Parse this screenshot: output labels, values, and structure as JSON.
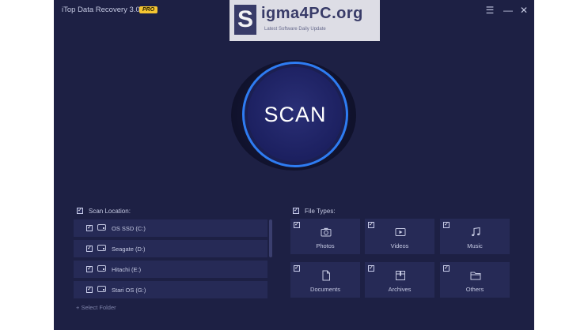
{
  "titlebar": {
    "app_title": "iTop Data Recovery 3.0",
    "badge": "PRO",
    "menu_glyph": "☰",
    "minimize_glyph": "—",
    "close_glyph": "✕"
  },
  "watermark": {
    "letter": "S",
    "text": "igma4PC.org",
    "subtitle": "Latest Software Daily Update"
  },
  "scan": {
    "label": "SCAN"
  },
  "scan_location": {
    "label": "Scan Location:",
    "items": [
      {
        "label": "OS SSD (C:)",
        "icon": "system-drive-icon"
      },
      {
        "label": "Seagate (D:)",
        "icon": "drive-icon"
      },
      {
        "label": "Hitachi (E:)",
        "icon": "drive-icon"
      },
      {
        "label": "Stari OS (G:)",
        "icon": "drive-icon"
      }
    ],
    "select_folder": "+  Select Folder"
  },
  "file_types": {
    "label": "File Types:",
    "items": [
      {
        "label": "Photos",
        "icon": "camera-icon"
      },
      {
        "label": "Videos",
        "icon": "video-icon"
      },
      {
        "label": "Music",
        "icon": "music-note-icon"
      },
      {
        "label": "Documents",
        "icon": "document-icon"
      },
      {
        "label": "Archives",
        "icon": "archive-icon"
      },
      {
        "label": "Others",
        "icon": "folder-icon"
      }
    ]
  },
  "colors": {
    "background": "#1d2044",
    "accent": "#2e7cf2",
    "badge": "#f5c531",
    "tile": "#262a56"
  }
}
